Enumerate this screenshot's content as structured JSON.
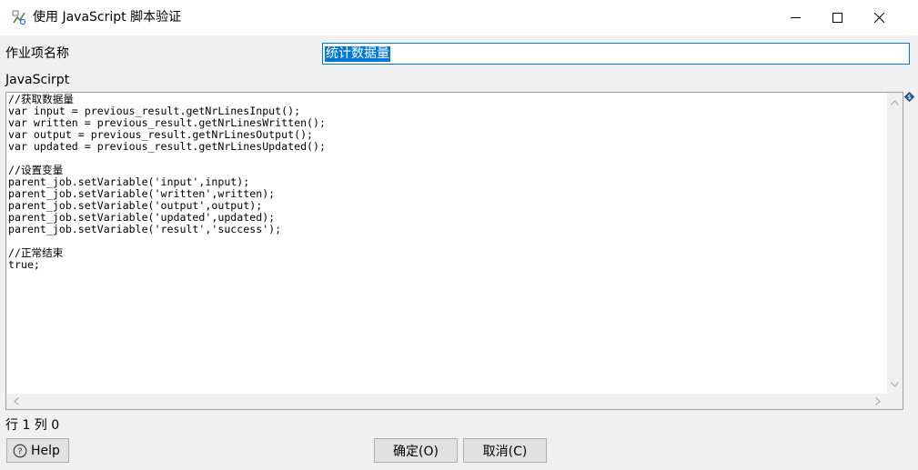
{
  "window": {
    "title": "使用 JavaScript 脚本验证"
  },
  "form": {
    "job_name_label": "作业项名称",
    "job_name_value": "统计数据量",
    "script_label": "JavaScirpt"
  },
  "editor": {
    "code": "//获取数据量\nvar input = previous_result.getNrLinesInput();\nvar written = previous_result.getNrLinesWritten();\nvar output = previous_result.getNrLinesOutput();\nvar updated = previous_result.getNrLinesUpdated();\n\n//设置变量\nparent_job.setVariable('input',input);\nparent_job.setVariable('written',written);\nparent_job.setVariable('output',output);\nparent_job.setVariable('updated',updated);\nparent_job.setVariable('result','success');\n\n//正常结束\ntrue;"
  },
  "status": {
    "position_text": "行 1 列 0"
  },
  "buttons": {
    "help_label": "Help",
    "ok_label": "确定(O)",
    "cancel_label": "取消(C)"
  },
  "colors": {
    "accent": "#0078d7",
    "dialog_bg": "#f0f0f0"
  },
  "icons": [
    "app-icon",
    "minimize-icon",
    "maximize-icon",
    "close-icon",
    "variable-icon",
    "help-icon",
    "scroll-up-icon",
    "scroll-down-icon",
    "scroll-left-icon",
    "scroll-right-icon"
  ]
}
